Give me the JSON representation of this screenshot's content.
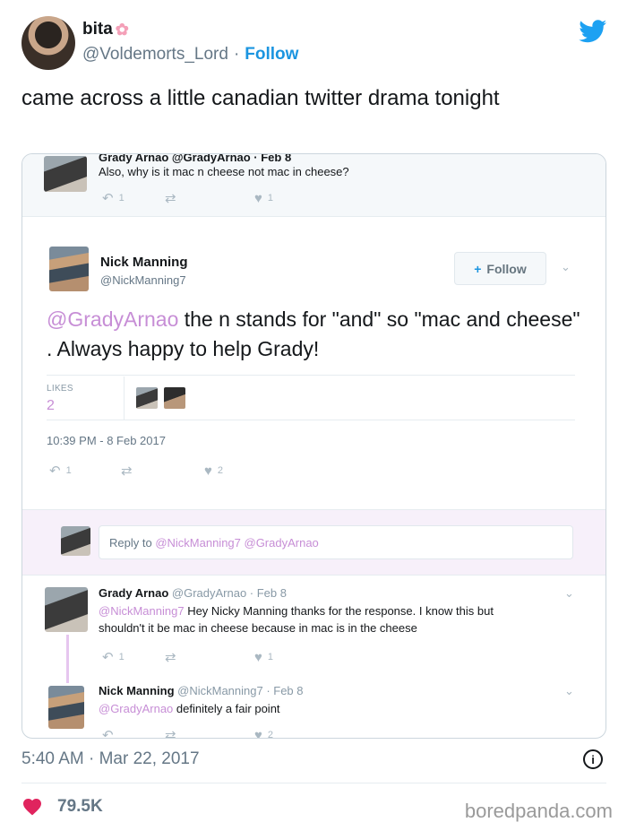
{
  "author": {
    "display_name": "bita",
    "handle": "@Voldemorts_Lord",
    "separator": "·",
    "follow_label": "Follow"
  },
  "tweet_text": "came across a little canadian twitter drama tonight",
  "embedded": {
    "top_tweet": {
      "cut_name": "Grady Arnao @GradyArnao · Feb 8",
      "text": "Also, why is it mac n cheese not mac in cheese?",
      "replies": "1",
      "likes": "1"
    },
    "main_tweet": {
      "name": "Nick Manning",
      "handle": "@NickManning7",
      "follow_label": "Follow",
      "mention": "@GradyArnao",
      "text": " the n stands for \"and\" so \"mac and cheese\" . Always happy to help Grady!",
      "likes_label": "LIKES",
      "likes_count": "2",
      "timestamp": "10:39 PM - 8 Feb 2017",
      "replies": "1",
      "like_action_count": "2"
    },
    "reply_box": {
      "prefix": "Reply to ",
      "mentions": "@NickManning7 @GradyArnao"
    },
    "reply1": {
      "name": "Grady Arnao",
      "meta": "@GradyArnao · Feb 8",
      "mention": "@NickManning7",
      "text_line1": " Hey Nicky Manning thanks for the response. I know this but",
      "text_line2": "shouldn't it be mac in cheese because in mac is in the cheese",
      "replies": "1",
      "likes": "1"
    },
    "reply2": {
      "name": "Nick Manning",
      "meta": "@NickManning7 · Feb 8",
      "mention": "@GradyArnao",
      "text": " definitely a fair point",
      "likes": "2"
    }
  },
  "footer": {
    "date": "5:40 AM · Mar 22, 2017",
    "like_count": "79.5K",
    "watermark": "boredpanda.com"
  },
  "colors": {
    "twitter_blue": "#1da1f2",
    "heart_red": "#e0245e",
    "mention_purple": "#c78ed6"
  }
}
